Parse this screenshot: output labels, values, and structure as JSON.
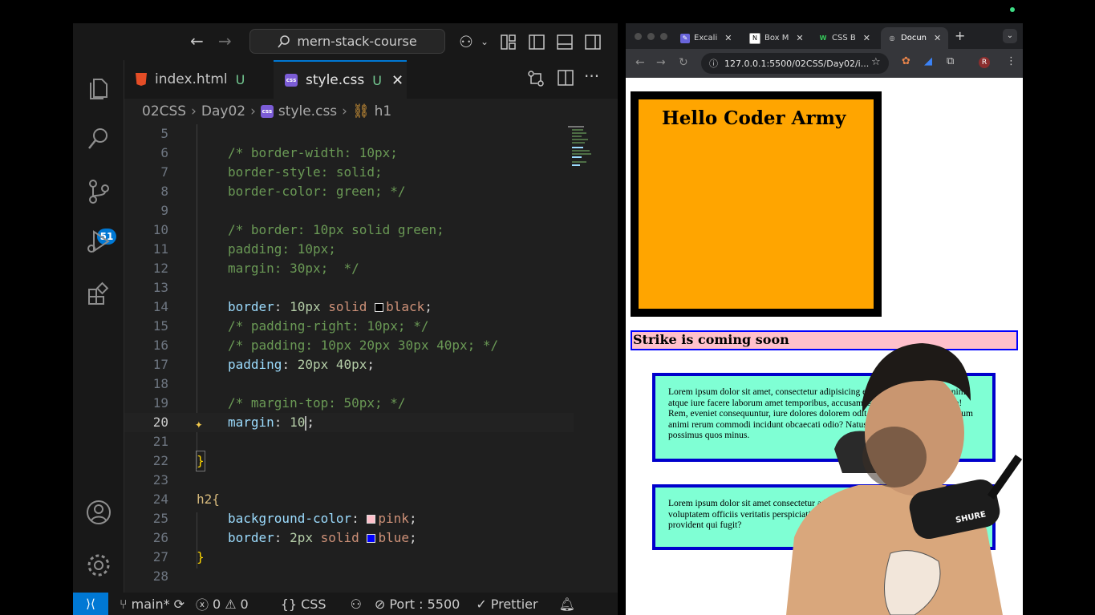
{
  "vscode": {
    "search_label": "mern-stack-course",
    "tabs": [
      {
        "label": "index.html",
        "status": "U"
      },
      {
        "label": "style.css",
        "status": "U"
      }
    ],
    "breadcrumb": [
      "02CSS",
      "Day02",
      "style.css",
      "h1"
    ],
    "scm_badge": "51",
    "code_lines": [
      {
        "n": "5"
      },
      {
        "n": "6",
        "text": "/* border-width: 10px;"
      },
      {
        "n": "7",
        "text": "border-style: solid;"
      },
      {
        "n": "8",
        "text": "border-color: green; */"
      },
      {
        "n": "9"
      },
      {
        "n": "10",
        "text": "/* border: 10px solid green;"
      },
      {
        "n": "11",
        "text": "padding: 10px;"
      },
      {
        "n": "12",
        "text": "margin: 30px;  */"
      },
      {
        "n": "13"
      },
      {
        "n": "14",
        "prop": "border",
        "val1": "10px",
        "val2": "solid",
        "val3": "black",
        "end": ";"
      },
      {
        "n": "15",
        "text": "/* padding-right: 10px; */"
      },
      {
        "n": "16",
        "text": "/* padding: 10px 20px 30px 40px; */"
      },
      {
        "n": "17",
        "prop": "padding",
        "val1": "20px",
        "val2": "40px",
        "end": ";"
      },
      {
        "n": "18"
      },
      {
        "n": "19",
        "text": "/* margin-top: 50px; */"
      },
      {
        "n": "20",
        "prop": "margin",
        "val1": "10",
        "end": ";"
      },
      {
        "n": "21"
      },
      {
        "n": "22",
        "text": "}"
      },
      {
        "n": "23"
      },
      {
        "n": "24",
        "text": "h2{"
      },
      {
        "n": "25",
        "prop": "background-color",
        "val1": "pink",
        "end": ";"
      },
      {
        "n": "26",
        "prop": "border",
        "val1": "2px",
        "val2": "solid",
        "val3": "blue",
        "end": ";"
      },
      {
        "n": "27",
        "text": "}"
      },
      {
        "n": "28"
      }
    ],
    "colon": ":",
    "status": {
      "branch": "main*",
      "errors": "0",
      "warnings": "0",
      "language": "CSS",
      "port": "Port : 5500",
      "formatter": "Prettier"
    }
  },
  "browser": {
    "tabs": [
      {
        "label": "Excali",
        "color": "#6965db",
        "glyph": "✎"
      },
      {
        "label": "Box M",
        "color": "#333333",
        "glyph": "N"
      },
      {
        "label": "CSS B",
        "color": "#2e7d32",
        "glyph": "W"
      },
      {
        "label": "Docun",
        "color": "#5f6368",
        "glyph": "◎"
      }
    ],
    "url": "127.0.0.1:5500/02CSS/Day02/i...",
    "profile": "R",
    "page": {
      "h1": "Hello Coder Army",
      "h2": "Strike is coming soon",
      "p1": "Lorem ipsum dolor sit amet, consectetur adipisicing elit. Voluptatibus quae enim atque iure facere laborum amet temporibus, accusamus ratione illum maiores a! Rem, eveniet consequuntur, iure dolores dolorem odit aut perspiciatis accusantium animi rerum commodi incidunt obcaecati odio? Natus, mollitia! Deserunt, quia possimus quos minus.",
      "p2": "Lorem ipsum dolor sit amet consectetur adipisicing elit. Culpa assumenda voluptatem officiis veritatis perspiciatis sunt illo numquam ipsum explicabo provident qui fugit?"
    }
  },
  "microphone_brand": "SHURE"
}
